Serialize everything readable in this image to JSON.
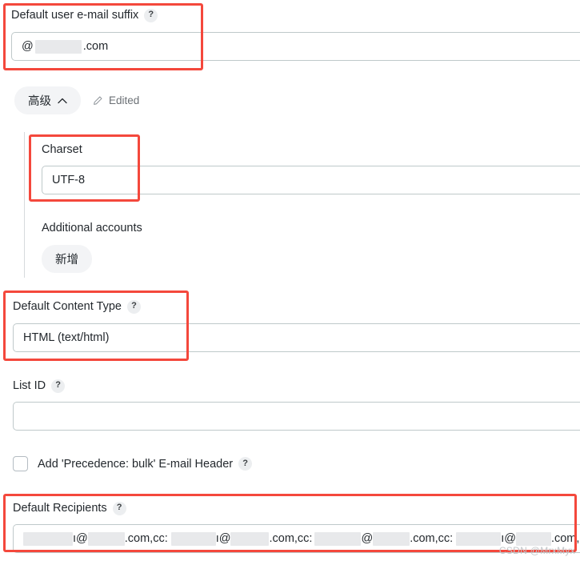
{
  "form": {
    "email_suffix": {
      "label": "Default user e-mail suffix",
      "help": "?",
      "value_prefix": "@",
      "value_suffix": ".com",
      "redacted": true
    },
    "advanced": {
      "toggle_label": "高级",
      "toggle_icon": "chevron-up-icon",
      "edited_label": "Edited",
      "edited_icon": "pencil-icon",
      "expanded": true
    },
    "charset": {
      "label": "Charset",
      "value": "UTF-8"
    },
    "additional_accounts": {
      "label": "Additional accounts",
      "add_button_label": "新增"
    },
    "content_type": {
      "label": "Default Content Type",
      "help": "?",
      "value": "HTML (text/html)"
    },
    "list_id": {
      "label": "List ID",
      "help": "?",
      "value": "",
      "placeholder": ""
    },
    "precedence": {
      "label": "Add 'Precedence: bulk' E-mail Header",
      "help": "?",
      "checked": false
    },
    "recipients": {
      "label": "Default Recipients",
      "help": "?",
      "segment_1": "ı@",
      "segment_2": ".com,cc:",
      "segment_3": "ı@",
      "segment_4": ".com,cc:",
      "segment_5": "@",
      "segment_6": ".com,cc:",
      "segment_7": "ı@",
      "segment_8": ".com,"
    }
  },
  "watermark": {
    "text": "CSDN @MrxMyx"
  },
  "colors": {
    "highlight": "#f4483c",
    "input_border": "#bfc9ca",
    "pill_background": "#f3f4f6",
    "redaction": "#e8e9eb",
    "text": "#23282d",
    "muted_text": "#6b7075"
  }
}
